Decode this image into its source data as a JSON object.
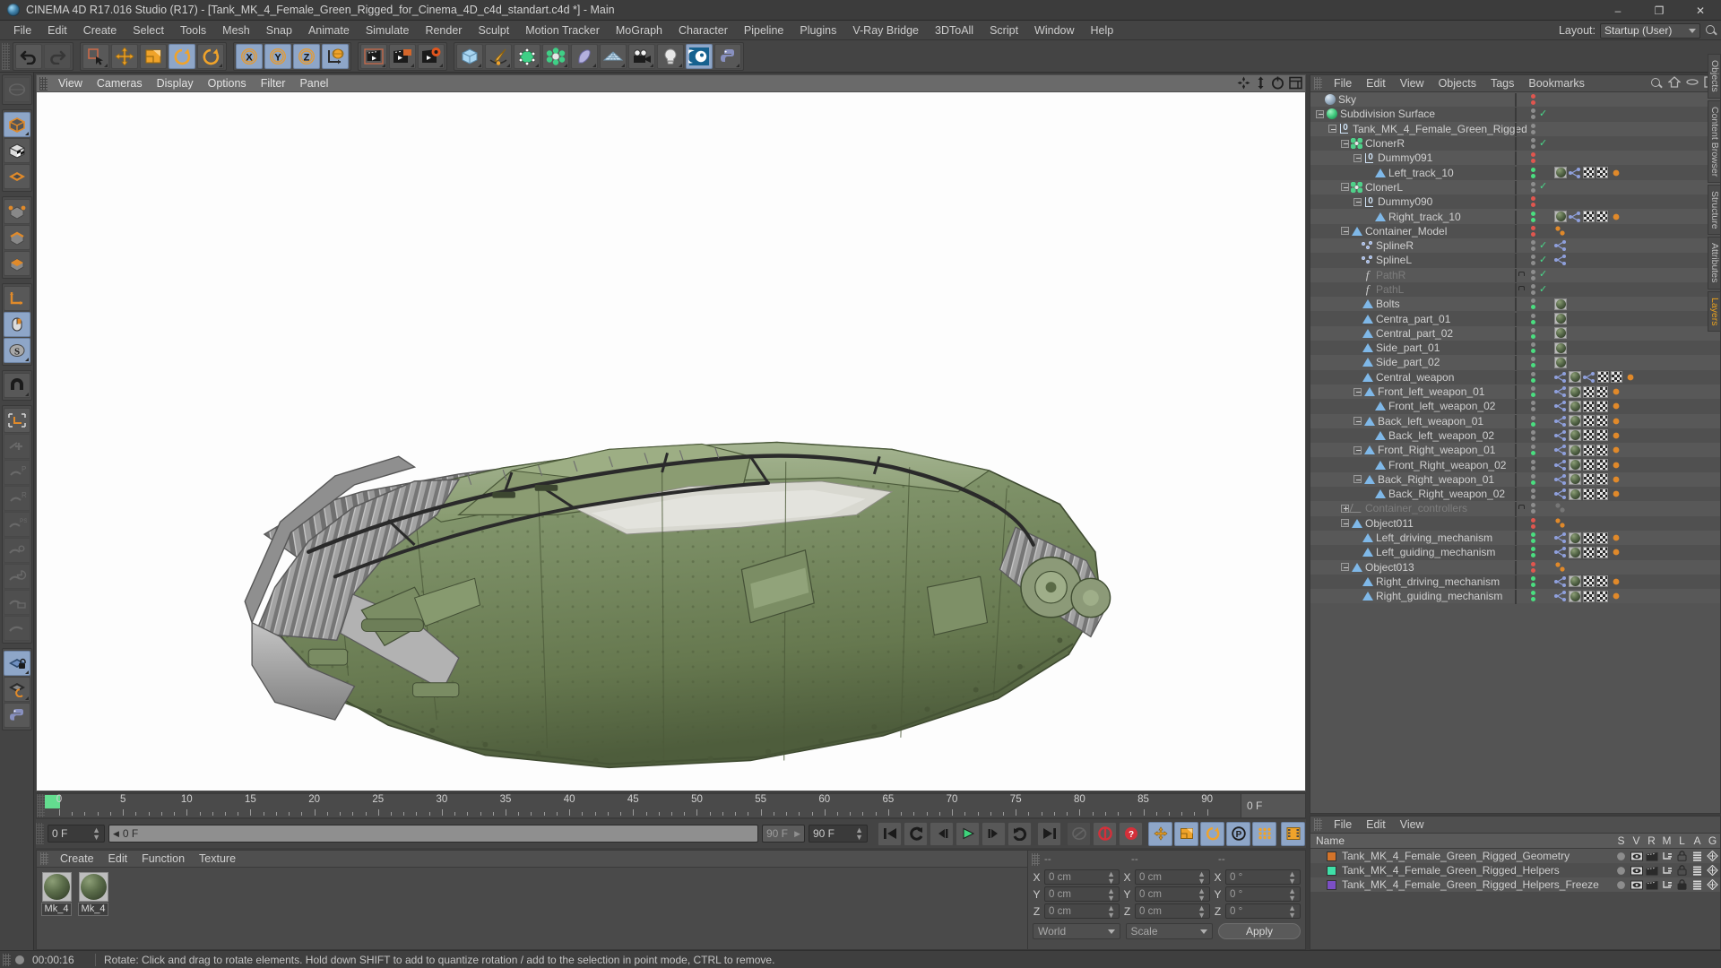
{
  "window": {
    "title": "CINEMA 4D R17.016 Studio (R17) - [Tank_MK_4_Female_Green_Rigged_for_Cinema_4D_c4d_standart.c4d *] - Main",
    "minimize": "–",
    "maximize": "❐",
    "close": "✕"
  },
  "menubar": {
    "items": [
      "File",
      "Edit",
      "Create",
      "Select",
      "Tools",
      "Mesh",
      "Snap",
      "Animate",
      "Simulate",
      "Render",
      "Sculpt",
      "Motion Tracker",
      "MoGraph",
      "Character",
      "Pipeline",
      "Plugins",
      "V-Ray Bridge",
      "3DToAll",
      "Script",
      "Window",
      "Help"
    ],
    "layout_label": "Layout:",
    "layout_value": "Startup (User)"
  },
  "viewport": {
    "menus": [
      "View",
      "Cameras",
      "Display",
      "Options",
      "Filter",
      "Panel"
    ]
  },
  "timeline": {
    "ticks": [
      0,
      5,
      10,
      15,
      20,
      25,
      30,
      35,
      40,
      45,
      50,
      55,
      60,
      65,
      70,
      75,
      80,
      85,
      90
    ],
    "current_frame_field": "0 F",
    "end_field_right": "0 F",
    "start_field": "0 F",
    "scrub_value": "0 F",
    "max_badge": "90 F",
    "end_frame_field": "90 F"
  },
  "transport": {
    "buttons": [
      {
        "name": "go-to-start-button",
        "icon": "skip-start"
      },
      {
        "name": "play-backwards-button",
        "icon": "rewind"
      },
      {
        "name": "previous-frame-button",
        "icon": "step-back"
      },
      {
        "name": "play-forwards-button",
        "icon": "play"
      },
      {
        "name": "next-frame-button",
        "icon": "step-forward"
      },
      {
        "name": "loop-button",
        "icon": "loop"
      },
      {
        "name": "go-to-end-button",
        "icon": "skip-end"
      },
      {
        "name": "record-active-objects-button",
        "icon": "keyframe-dim"
      },
      {
        "name": "autokeying-button",
        "icon": "record-red"
      },
      {
        "name": "keyframe-selection-button",
        "icon": "question-red"
      },
      {
        "name": "position-key-button",
        "icon": "move-key"
      },
      {
        "name": "scale-key-button",
        "icon": "scale-key"
      },
      {
        "name": "rotation-key-button",
        "icon": "rotate-key"
      },
      {
        "name": "param-key-button",
        "icon": "p-key"
      },
      {
        "name": "point-level-animation-button",
        "icon": "pla-dots"
      },
      {
        "name": "timeline-button",
        "icon": "timeline-strip"
      }
    ]
  },
  "materials": {
    "menus": [
      "Create",
      "Edit",
      "Function",
      "Texture"
    ],
    "items": [
      {
        "name": "Mk_4"
      },
      {
        "name": "Mk_4"
      }
    ]
  },
  "coordinates": {
    "headers": [
      "--",
      "--",
      "--"
    ],
    "rows": [
      {
        "axis": "X",
        "position": "0 cm",
        "size": "0 cm",
        "rotation": "0 °"
      },
      {
        "axis": "Y",
        "position": "0 cm",
        "size": "0 cm",
        "rotation": "0 °"
      },
      {
        "axis": "Z",
        "position": "0 cm",
        "size": "0 cm",
        "rotation": "0 °"
      }
    ],
    "coord_system": "World",
    "mode": "Scale",
    "apply_label": "Apply"
  },
  "statusbar": {
    "time": "00:00:16",
    "message": "Rotate: Click and drag to rotate elements. Hold down SHIFT to add to quantize rotation / add to the selection in point mode, CTRL to remove."
  },
  "object_manager": {
    "menus": [
      "File",
      "Edit",
      "View",
      "Objects",
      "Tags",
      "Bookmarks"
    ],
    "items": [
      {
        "label": "Sky",
        "depth": 1,
        "icon": "sky",
        "toggle": "none",
        "layer": "none",
        "dots": [
          "red",
          "red"
        ],
        "check": false,
        "tags": []
      },
      {
        "label": "Subdivision Surface",
        "depth": 1,
        "icon": "subdivision",
        "toggle": "minus",
        "layer": "none",
        "dots": [
          "gray",
          "gray"
        ],
        "check": true,
        "tags": []
      },
      {
        "label": "Tank_MK_4_Female_Green_Rigged",
        "depth": 2,
        "icon": "null",
        "toggle": "minus",
        "layer": "orange",
        "dots": [
          "gray",
          "gray"
        ],
        "check": false,
        "tags": []
      },
      {
        "label": "ClonerR",
        "depth": 3,
        "icon": "cloner",
        "toggle": "minus",
        "layer": "orange",
        "dots": [
          "gray",
          "gray"
        ],
        "check": true,
        "tags": []
      },
      {
        "label": "Dummy091",
        "depth": 4,
        "icon": "null",
        "toggle": "minus",
        "layer": "orange",
        "dots": [
          "red",
          "red"
        ],
        "check": false,
        "tags": []
      },
      {
        "label": "Left_track_10",
        "depth": 5,
        "icon": "poly",
        "toggle": "none",
        "layer": "orange",
        "dots": [
          "green",
          "green"
        ],
        "check": false,
        "tags": [
          "mat",
          "node",
          "checker",
          "checker",
          "orange"
        ]
      },
      {
        "label": "ClonerL",
        "depth": 3,
        "icon": "cloner",
        "toggle": "minus",
        "layer": "orange",
        "dots": [
          "gray",
          "gray"
        ],
        "check": true,
        "tags": []
      },
      {
        "label": "Dummy090",
        "depth": 4,
        "icon": "null",
        "toggle": "minus",
        "layer": "orange",
        "dots": [
          "red",
          "red"
        ],
        "check": false,
        "tags": []
      },
      {
        "label": "Right_track_10",
        "depth": 5,
        "icon": "poly",
        "toggle": "none",
        "layer": "orange",
        "dots": [
          "green",
          "green"
        ],
        "check": false,
        "tags": [
          "mat",
          "node",
          "checker",
          "checker",
          "orange"
        ]
      },
      {
        "label": "Container_Model",
        "depth": 3,
        "icon": "poly",
        "toggle": "minus",
        "layer": "teal",
        "dots": [
          "red",
          "red"
        ],
        "check": false,
        "tags": [
          "orange2"
        ]
      },
      {
        "label": "SplineR",
        "depth": 4,
        "icon": "spline",
        "toggle": "none",
        "layer": "orange",
        "dots": [
          "gray",
          "gray"
        ],
        "check": true,
        "tags": [
          "node"
        ]
      },
      {
        "label": "SplineL",
        "depth": 4,
        "icon": "spline",
        "toggle": "none",
        "layer": "orange",
        "dots": [
          "gray",
          "gray"
        ],
        "check": true,
        "tags": [
          "node"
        ]
      },
      {
        "label": "PathR",
        "depth": 4,
        "icon": "path",
        "toggle": "none",
        "layer": "purple",
        "dots": [
          "gray",
          "gray"
        ],
        "check": true,
        "muted": true,
        "tags": []
      },
      {
        "label": "PathL",
        "depth": 4,
        "icon": "path",
        "toggle": "none",
        "layer": "purple",
        "dots": [
          "gray",
          "gray"
        ],
        "check": true,
        "muted": true,
        "tags": []
      },
      {
        "label": "Bolts",
        "depth": 4,
        "icon": "poly",
        "toggle": "none",
        "layer": "orange",
        "dots": [
          "gray",
          "green"
        ],
        "check": false,
        "tags": [
          "mat"
        ]
      },
      {
        "label": "Centra_part_01",
        "depth": 4,
        "icon": "poly",
        "toggle": "none",
        "layer": "orange",
        "dots": [
          "gray",
          "green"
        ],
        "check": false,
        "tags": [
          "mat"
        ]
      },
      {
        "label": "Central_part_02",
        "depth": 4,
        "icon": "poly",
        "toggle": "none",
        "layer": "orange",
        "dots": [
          "gray",
          "green"
        ],
        "check": false,
        "tags": [
          "mat"
        ]
      },
      {
        "label": "Side_part_01",
        "depth": 4,
        "icon": "poly",
        "toggle": "none",
        "layer": "orange",
        "dots": [
          "gray",
          "green"
        ],
        "check": false,
        "tags": [
          "mat"
        ]
      },
      {
        "label": "Side_part_02",
        "depth": 4,
        "icon": "poly",
        "toggle": "none",
        "layer": "orange",
        "dots": [
          "gray",
          "green"
        ],
        "check": false,
        "tags": [
          "mat"
        ]
      },
      {
        "label": "Central_weapon",
        "depth": 4,
        "icon": "poly",
        "toggle": "none",
        "layer": "orange",
        "dots": [
          "gray",
          "green"
        ],
        "check": false,
        "tags": [
          "node",
          "mat",
          "node",
          "checker",
          "checker",
          "orange"
        ]
      },
      {
        "label": "Front_left_weapon_01",
        "depth": 4,
        "icon": "poly",
        "toggle": "minus",
        "layer": "orange",
        "dots": [
          "gray",
          "green"
        ],
        "check": false,
        "tags": [
          "node",
          "mat",
          "checker",
          "checker",
          "orange"
        ]
      },
      {
        "label": "Front_left_weapon_02",
        "depth": 5,
        "icon": "poly",
        "toggle": "none",
        "layer": "orange",
        "dots": [
          "gray",
          "gray"
        ],
        "check": false,
        "tags": [
          "node",
          "mat",
          "checker",
          "checker",
          "orange"
        ]
      },
      {
        "label": "Back_left_weapon_01",
        "depth": 4,
        "icon": "poly",
        "toggle": "minus",
        "layer": "orange",
        "dots": [
          "gray",
          "green"
        ],
        "check": false,
        "tags": [
          "node",
          "mat",
          "checker",
          "checker",
          "orange"
        ]
      },
      {
        "label": "Back_left_weapon_02",
        "depth": 5,
        "icon": "poly",
        "toggle": "none",
        "layer": "orange",
        "dots": [
          "gray",
          "gray"
        ],
        "check": false,
        "tags": [
          "node",
          "mat",
          "checker",
          "checker",
          "orange"
        ]
      },
      {
        "label": "Front_Right_weapon_01",
        "depth": 4,
        "icon": "poly",
        "toggle": "minus",
        "layer": "orange",
        "dots": [
          "gray",
          "green"
        ],
        "check": false,
        "tags": [
          "node",
          "mat",
          "checker",
          "checker",
          "orange"
        ]
      },
      {
        "label": "Front_Right_weapon_02",
        "depth": 5,
        "icon": "poly",
        "toggle": "none",
        "layer": "orange",
        "dots": [
          "gray",
          "gray"
        ],
        "check": false,
        "tags": [
          "node",
          "mat",
          "checker",
          "checker",
          "orange"
        ]
      },
      {
        "label": "Back_Right_weapon_01",
        "depth": 4,
        "icon": "poly",
        "toggle": "minus",
        "layer": "orange",
        "dots": [
          "gray",
          "green"
        ],
        "check": false,
        "tags": [
          "node",
          "mat",
          "checker",
          "checker",
          "orange"
        ]
      },
      {
        "label": "Back_Right_weapon_02",
        "depth": 5,
        "icon": "poly",
        "toggle": "none",
        "layer": "orange",
        "dots": [
          "gray",
          "gray"
        ],
        "check": false,
        "tags": [
          "node",
          "mat",
          "checker",
          "checker",
          "orange"
        ]
      },
      {
        "label": "Container_controllers",
        "depth": 3,
        "icon": "controller",
        "toggle": "plus",
        "layer": "purple",
        "dots": [
          "gray",
          "gray"
        ],
        "check": false,
        "muted": true,
        "tags": [
          "gray"
        ]
      },
      {
        "label": "Object011",
        "depth": 3,
        "icon": "poly",
        "toggle": "minus",
        "layer": "orange",
        "dots": [
          "red",
          "red"
        ],
        "check": false,
        "tags": [
          "orange2"
        ]
      },
      {
        "label": "Left_driving_mechanism",
        "depth": 4,
        "icon": "poly",
        "toggle": "none",
        "layer": "orange",
        "dots": [
          "green",
          "green"
        ],
        "check": false,
        "tags": [
          "node",
          "mat",
          "checker",
          "checker",
          "orange"
        ]
      },
      {
        "label": "Left_guiding_mechanism",
        "depth": 4,
        "icon": "poly",
        "toggle": "none",
        "layer": "orange",
        "dots": [
          "green",
          "green"
        ],
        "check": false,
        "tags": [
          "node",
          "mat",
          "checker",
          "checker",
          "orange"
        ]
      },
      {
        "label": "Object013",
        "depth": 3,
        "icon": "poly",
        "toggle": "minus",
        "layer": "orange",
        "dots": [
          "red",
          "red"
        ],
        "check": false,
        "tags": [
          "orange2"
        ]
      },
      {
        "label": "Right_driving_mechanism",
        "depth": 4,
        "icon": "poly",
        "toggle": "none",
        "layer": "orange",
        "dots": [
          "green",
          "green"
        ],
        "check": false,
        "tags": [
          "node",
          "mat",
          "checker",
          "checker",
          "orange"
        ]
      },
      {
        "label": "Right_guiding_mechanism",
        "depth": 4,
        "icon": "poly",
        "toggle": "none",
        "layer": "orange",
        "dots": [
          "green",
          "green"
        ],
        "check": false,
        "tags": [
          "node",
          "mat",
          "checker",
          "checker",
          "orange"
        ]
      }
    ]
  },
  "layer_manager": {
    "menus": [
      "File",
      "Edit",
      "View"
    ],
    "columns": [
      "Name",
      "S",
      "V",
      "R",
      "M",
      "L",
      "A",
      "G"
    ],
    "rows": [
      {
        "name": "Tank_MK_4_Female_Green_Rigged_Geometry",
        "color": "#d4742a",
        "locked": false
      },
      {
        "name": "Tank_MK_4_Female_Green_Rigged_Helpers",
        "color": "#3fe0a8",
        "locked": false
      },
      {
        "name": "Tank_MK_4_Female_Green_Rigged_Helpers_Freeze",
        "color": "#7b4fc4",
        "locked": true
      }
    ]
  },
  "side_tabs": [
    "Objects",
    "Content Browser",
    "Structure",
    "Attributes",
    "Layers"
  ],
  "colors": {
    "accent_orange": "#e0892a",
    "accent_green": "#49d98a",
    "layer_orange": "#d4742a",
    "layer_teal": "#3fe0a8",
    "layer_purple": "#7b4fc4",
    "selection_blue": "#8ea6c8"
  }
}
